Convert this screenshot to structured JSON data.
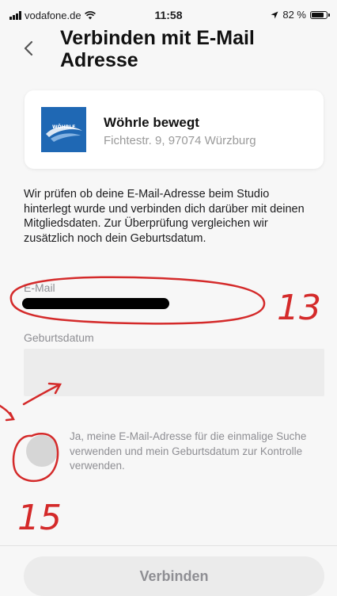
{
  "status_bar": {
    "carrier": "vodafone.de",
    "time": "11:58",
    "battery": "82 %"
  },
  "header": {
    "title": "Verbinden mit E-Mail Adresse"
  },
  "studio": {
    "logo_text": "WÖHRLE",
    "name": "Wöhrle bewegt",
    "address": "Fichtestr. 9, 97074 Würzburg"
  },
  "description": "Wir prüfen ob deine E-Mail-Adresse beim Studio hinterlegt wurde und verbinden dich darüber mit deinen Mitgliedsdaten. Zur Überprüfung vergleichen wir zusätzlich noch dein Geburtsdatum.",
  "form": {
    "email_label": "E-Mail",
    "email_value": "",
    "birthdate_label": "Geburtsdatum",
    "birthdate_value": "",
    "consent_text": "Ja, meine E-Mail-Adresse für die einmalige Suche verwenden und mein Geburtsdatum zur Kontrolle verwenden.",
    "consent_checked": false
  },
  "submit_label": "Verbinden",
  "annotations": {
    "label_13": "13",
    "label_15": "15",
    "color": "#d42a2a"
  }
}
